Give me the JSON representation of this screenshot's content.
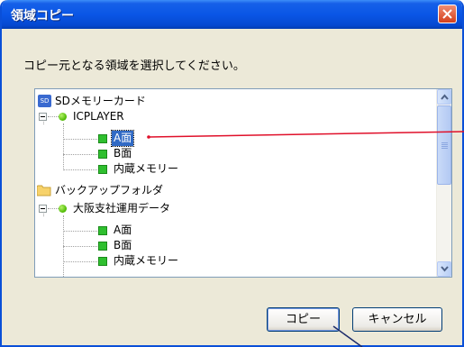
{
  "window": {
    "title": "領域コピー"
  },
  "instruction": "コピー元となる領域を選択してください。",
  "tree": {
    "root_icon_text": "SD",
    "items": [
      {
        "label": "SDメモリーカード",
        "icon": "sd-card-icon"
      },
      {
        "label": "ICPLAYER",
        "icon": "green-dot-icon"
      },
      {
        "label": "A面",
        "icon": "green-square-icon",
        "selected": true
      },
      {
        "label": "B面",
        "icon": "green-square-icon"
      },
      {
        "label": "内蔵メモリー",
        "icon": "green-square-icon"
      },
      {
        "label": "バックアップフォルダ",
        "icon": "folder-icon"
      },
      {
        "label": "大阪支社運用データ",
        "icon": "green-dot-icon"
      },
      {
        "label": "A面",
        "icon": "green-square-icon"
      },
      {
        "label": "B面",
        "icon": "green-square-icon"
      },
      {
        "label": "内蔵メモリー",
        "icon": "green-square-icon"
      }
    ]
  },
  "buttons": {
    "copy": "コピー",
    "cancel": "キャンセル"
  },
  "colors": {
    "titlebar": "#0a56e6",
    "selection": "#316ac5",
    "callout": "#e0102a"
  }
}
